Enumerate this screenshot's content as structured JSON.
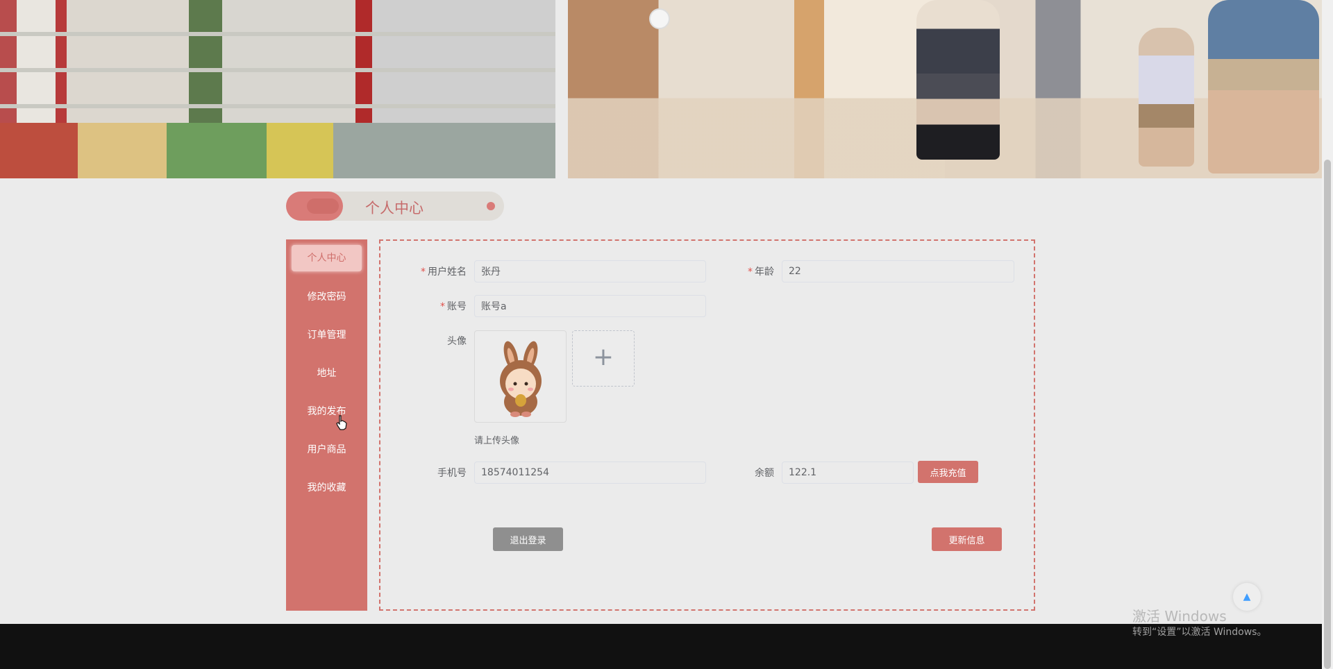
{
  "title_bar": {
    "title": "个人中心"
  },
  "sidebar": {
    "items": [
      {
        "label": "个人中心",
        "active": true
      },
      {
        "label": "修改密码",
        "active": false
      },
      {
        "label": "订单管理",
        "active": false
      },
      {
        "label": "地址",
        "active": false
      },
      {
        "label": "我的发布",
        "active": false
      },
      {
        "label": "用户商品",
        "active": false
      },
      {
        "label": "我的收藏",
        "active": false
      }
    ]
  },
  "form": {
    "required_mark": "*",
    "username": {
      "label": "用户姓名",
      "value": "张丹"
    },
    "age": {
      "label": "年龄",
      "value": "22"
    },
    "account": {
      "label": "账号",
      "value": "账号a"
    },
    "avatar": {
      "label": "头像",
      "hint": "请上传头像",
      "upload_icon": "plus-icon",
      "upload_symbol": "+"
    },
    "phone": {
      "label": "手机号",
      "value": "18574011254"
    },
    "balance": {
      "label": "余额",
      "value": "122.1"
    },
    "recharge_button": "点我充值",
    "logout_button": "退出登录",
    "update_button": "更新信息"
  },
  "back_to_top": {
    "icon": "caret-up-icon",
    "symbol": "▲"
  },
  "watermark": {
    "title": "激活 Windows",
    "subtitle": "转到“设置”以激活 Windows。"
  },
  "colors": {
    "accent": "#d2736d",
    "background": "#ebebeb",
    "footer": "#111111",
    "logout": "#8f8f8f"
  }
}
